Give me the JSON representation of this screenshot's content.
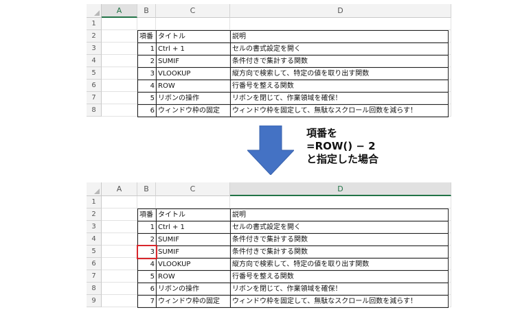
{
  "columns": [
    "A",
    "B",
    "C",
    "D"
  ],
  "rows_top": [
    "1",
    "2",
    "3",
    "4",
    "5",
    "6",
    "7",
    "8"
  ],
  "rows_bottom": [
    "1",
    "2",
    "3",
    "4",
    "5",
    "6",
    "7",
    "8",
    "9"
  ],
  "table_header": {
    "b": "項番",
    "c": "タイトル",
    "d": "説明"
  },
  "table_top": [
    {
      "num": "1",
      "title": "Ctrl + 1",
      "desc": "セルの書式設定を開く"
    },
    {
      "num": "2",
      "title": "SUMIF",
      "desc": "条件付きで集計する関数"
    },
    {
      "num": "3",
      "title": "VLOOKUP",
      "desc": "縦方向で検索して、特定の値を取り出す関数"
    },
    {
      "num": "4",
      "title": "ROW",
      "desc": "行番号を整える関数"
    },
    {
      "num": "5",
      "title": "リボンの操作",
      "desc": "リボンを閉じて、作業領域を確保！"
    },
    {
      "num": "6",
      "title": "ウィンドウ枠の固定",
      "desc": "ウィンドウ枠を固定して、無駄なスクロール回数を減らす！"
    }
  ],
  "table_bottom": [
    {
      "num": "1",
      "title": "Ctrl + 1",
      "desc": "セルの書式設定を開く"
    },
    {
      "num": "2",
      "title": "SUMIF",
      "desc": "条件付きで集計する関数"
    },
    {
      "num": "3",
      "title": "SUMIF",
      "desc": "条件付きで集計する関数"
    },
    {
      "num": "4",
      "title": "VLOOKUP",
      "desc": "縦方向で検索して、特定の値を取り出す関数"
    },
    {
      "num": "5",
      "title": "ROW",
      "desc": "行番号を整える関数"
    },
    {
      "num": "6",
      "title": "リボンの操作",
      "desc": "リボンを閉じて、作業領域を確保！"
    },
    {
      "num": "7",
      "title": "ウィンドウ枠の固定",
      "desc": "ウィンドウ枠を固定して、無駄なスクロール回数を減らす！"
    }
  ],
  "annotation": {
    "line1": "項番を",
    "line2": "=ROW() − 2",
    "line3": "と指定した場合"
  },
  "colors": {
    "arrow": "#4472c4",
    "selection": "#d8262b",
    "excel_green": "#217346"
  }
}
